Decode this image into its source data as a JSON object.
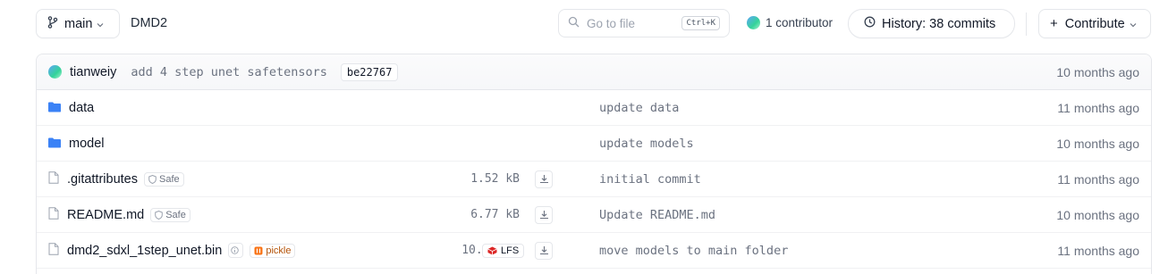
{
  "toolbar": {
    "branch_label": "main",
    "repo_name": "DMD2",
    "search_placeholder": "Go to file",
    "search_shortcut": "Ctrl+K",
    "contributors_text": "1 contributor",
    "history_label": "History: 38 commits",
    "contribute_label": "Contribute"
  },
  "last_commit": {
    "author": "tianweiy",
    "message": "add 4 step unet safetensors",
    "hash": "be22767",
    "date": "10 months ago"
  },
  "files": [
    {
      "type": "folder",
      "name": "data",
      "size": "",
      "message": "update data",
      "date": "11 months ago"
    },
    {
      "type": "folder",
      "name": "model",
      "size": "",
      "message": "update models",
      "date": "10 months ago"
    },
    {
      "type": "file",
      "name": ".gitattributes",
      "safe_tag": "Safe",
      "size": "1.52 kB",
      "message": "initial commit",
      "date": "11 months ago"
    },
    {
      "type": "file",
      "name": "README.md",
      "safe_tag": "Safe",
      "size": "6.77 kB",
      "message": "Update README.md",
      "date": "10 months ago"
    },
    {
      "type": "file",
      "name": "dmd2_sdxl_1step_unet.bin",
      "pickle_tag": "pickle",
      "lfs_tag": "LFS",
      "size": "10.3 GB",
      "message": "move models to main folder",
      "date": "11 months ago"
    }
  ],
  "colors": {
    "folder": "#3b82f6",
    "pickle": "#f97316",
    "lfs": "#dc2626"
  }
}
